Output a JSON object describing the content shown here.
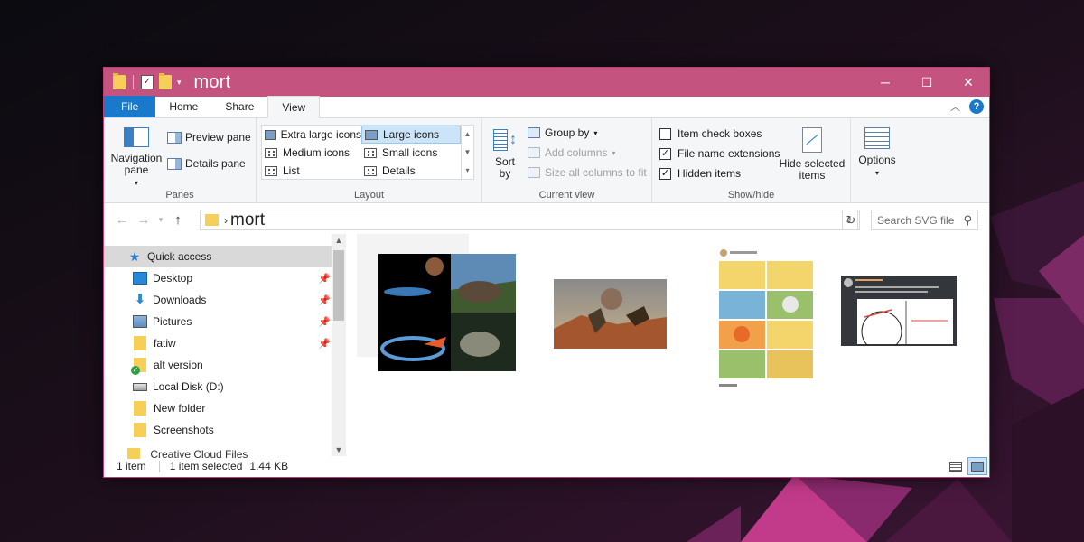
{
  "window": {
    "title": "mort"
  },
  "tabs": [
    "File",
    "Home",
    "Share",
    "View"
  ],
  "ribbon": {
    "panes": {
      "label": "Panes",
      "navigation_pane": "Navigation pane",
      "preview_pane": "Preview pane",
      "details_pane": "Details pane"
    },
    "layout": {
      "label": "Layout",
      "items": [
        "Extra large icons",
        "Large icons",
        "Medium icons",
        "Small icons",
        "List",
        "Details"
      ],
      "selected": "Large icons"
    },
    "current_view": {
      "label": "Current view",
      "sort_by": "Sort by",
      "group_by": "Group by",
      "add_columns": "Add columns",
      "size_all_columns": "Size all columns to fit"
    },
    "show_hide": {
      "label": "Show/hide",
      "item_check_boxes": "Item check boxes",
      "file_name_extensions": "File name extensions",
      "hidden_items": "Hidden items",
      "hide_selected_items": "Hide selected items",
      "checked": {
        "item_check_boxes": false,
        "file_name_extensions": true,
        "hidden_items": true
      }
    },
    "options": "Options"
  },
  "address": {
    "path": "mort",
    "search_placeholder": "Search SVG file"
  },
  "nav": {
    "quick_access": "Quick access",
    "items": [
      "Desktop",
      "Downloads",
      "Pictures",
      "fatiw",
      "alt version",
      "Local Disk (D:)",
      "New folder",
      "Screenshots"
    ],
    "partial_item": "Creative Cloud Files"
  },
  "status": {
    "count": "1 item",
    "selection": "1 item selected",
    "size": "1.44 KB"
  },
  "colors": {
    "titlebar": "#c5537f",
    "file_tab": "#1979ca",
    "selection": "#cce4f7"
  }
}
